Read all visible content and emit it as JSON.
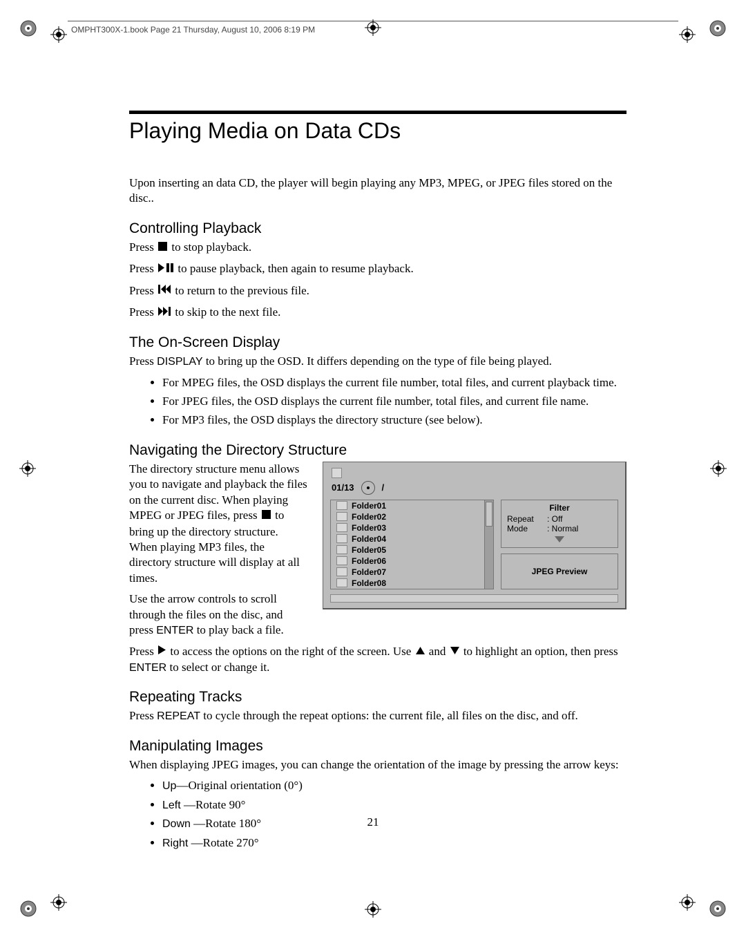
{
  "header_note": "OMPHT300X-1.book  Page 21  Thursday, August 10, 2006  8:19 PM",
  "title": "Playing Media on Data CDs",
  "intro": "Upon inserting an data CD, the player will begin playing any MP3, MPEG, or JPEG files stored on the disc..",
  "h_playback": "Controlling Playback",
  "p_stop_a": "Press ",
  "p_stop_b": " to stop playback.",
  "p_pause_a": "Press ",
  "p_pause_b": " to pause playback, then again to resume playback.",
  "p_prev_a": "Press ",
  "p_prev_b": " to return to the previous file.",
  "p_next_a": "Press ",
  "p_next_b": " to skip to the next file.",
  "h_osd": "The On-Screen Display",
  "p_osd_a": "Press ",
  "k_display": "DISPLAY",
  "p_osd_b": " to bring up the OSD. It differs depending on the type of file being played.",
  "li_mpeg": "For MPEG files, the OSD displays the current file number, total files, and current playback time.",
  "li_jpeg": "For JPEG files, the OSD displays the current file number, total files, and current file name.",
  "li_mp3": "For MP3 files, the OSD displays the directory structure (see below).",
  "h_nav": "Navigating the Directory Structure",
  "p_nav1_a": "The directory structure menu allows you to navigate and playback the files on the current disc. When playing MPEG or JPEG files, press ",
  "p_nav1_b": " to bring up the directory structure. When playing MP3 files, the directory structure will display at all times.",
  "p_nav2_a": "Use the arrow controls to scroll through the files on the disc, and press ",
  "k_enter": "ENTER",
  "p_nav2_b": " to play back a file.",
  "p_nav3_a": "Press ",
  "p_nav3_b": " to access the options on the right of the screen. Use ",
  "p_nav3_c": " and ",
  "p_nav3_d": " to highlight an option, then press ",
  "p_nav3_e": " to select or change it.",
  "h_repeat": "Repeating Tracks",
  "p_repeat_a": "Press ",
  "k_repeat": "REPEAT",
  "p_repeat_b": " to cycle through the repeat options: the current file, all files on the disc, and off.",
  "h_images": "Manipulating Images",
  "p_images": "When displaying JPEG images, you can change the orientation of the image by pressing the arrow keys:",
  "li_up_a": "Up",
  "li_up_b": "—Original orientation (0°)",
  "li_left_a": "Left",
  "li_left_b": " —Rotate 90°",
  "li_down_a": "Down",
  "li_down_b": " —Rotate 180°",
  "li_right_a": "Right",
  "li_right_b": " —Rotate 270°",
  "osd": {
    "counter": "01/13",
    "slash": "/",
    "folders": [
      "Folder01",
      "Folder02",
      "Folder03",
      "Folder04",
      "Folder05",
      "Folder06",
      "Folder07",
      "Folder08"
    ],
    "filter": "Filter",
    "repeat_l": "Repeat",
    "repeat_v": ": Off",
    "mode_l": "Mode",
    "mode_v": ": Normal",
    "preview": "JPEG Preview"
  },
  "page_number": "21"
}
